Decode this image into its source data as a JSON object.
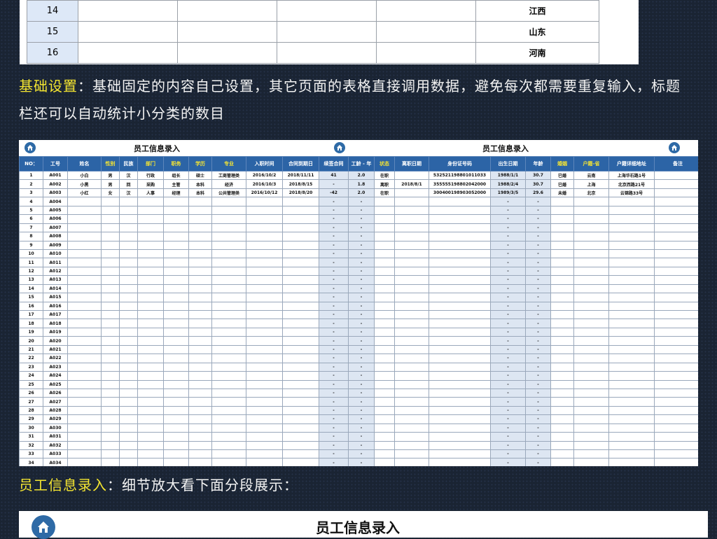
{
  "top_sheet": {
    "rows": [
      {
        "num": "14",
        "province": "江西"
      },
      {
        "num": "15",
        "province": "山东"
      },
      {
        "num": "16",
        "province": "河南"
      }
    ]
  },
  "caption1": {
    "highlight": "基础设置",
    "text": "：基础固定的内容自己设置，其它页面的表格直接调用数据，避免每次都需要重复输入，标题栏还可以自动统计小分类的数目"
  },
  "sheet": {
    "title": "员工信息录入",
    "headers": [
      {
        "label": "NO：",
        "yellow": false
      },
      {
        "label": "工号",
        "yellow": false
      },
      {
        "label": "姓名",
        "yellow": false
      },
      {
        "label": "性别",
        "yellow": true
      },
      {
        "label": "民族",
        "yellow": false
      },
      {
        "label": "部门",
        "yellow": true
      },
      {
        "label": "职务",
        "yellow": true
      },
      {
        "label": "学历",
        "yellow": true
      },
      {
        "label": "专业",
        "yellow": true
      },
      {
        "label": "入职时间",
        "yellow": false
      },
      {
        "label": "合同到期日",
        "yellow": false
      },
      {
        "label": "续签合同",
        "yellow": false
      },
      {
        "label": "工龄 - 年",
        "yellow": false
      },
      {
        "label": "状态",
        "yellow": true
      },
      {
        "label": "离职日期",
        "yellow": false
      },
      {
        "label": "身份证号码",
        "yellow": false
      },
      {
        "label": "出生日期",
        "yellow": false
      },
      {
        "label": "年龄",
        "yellow": false
      },
      {
        "label": "婚姻",
        "yellow": true
      },
      {
        "label": "户籍-省",
        "yellow": true
      },
      {
        "label": "户籍详细地址",
        "yellow": false
      },
      {
        "label": "备注",
        "yellow": false
      }
    ],
    "rows": [
      [
        "1",
        "A001",
        "小白",
        "男",
        "汉",
        "行政",
        "组长",
        "硕士",
        "工商管理类",
        "2016/10/2",
        "2018/11/11",
        "41",
        "2.0",
        "在职",
        "",
        "532521198801011033",
        "1988/1/1",
        "30.7",
        "已婚",
        "云南",
        "上海华石路1号",
        ""
      ],
      [
        "2",
        "A002",
        "小黑",
        "男",
        "回",
        "采购",
        "主管",
        "本科",
        "经济",
        "2016/10/3",
        "2018/8/15",
        "-",
        "1.8",
        "离职",
        "2018/8/1",
        "355555198802042000",
        "1988/2/4",
        "30.7",
        "已婚",
        "上海",
        "北京西路21号",
        ""
      ],
      [
        "3",
        "A003",
        "小红",
        "女",
        "汉",
        "人事",
        "经理",
        "本科",
        "公共管理类",
        "2016/10/12",
        "2018/8/20",
        "-42",
        "2.0",
        "在职",
        "",
        "300400198903052000",
        "1989/3/5",
        "29.6",
        "未婚",
        "北京",
        "云锦路33号",
        ""
      ]
    ],
    "blank_ids": [
      "A004",
      "A005",
      "A006",
      "A007",
      "A008",
      "A009",
      "A010",
      "A011",
      "A012",
      "A013",
      "A014",
      "A015",
      "A016",
      "A017",
      "A018",
      "A019",
      "A020",
      "A021",
      "A022",
      "A023",
      "A024",
      "A025",
      "A026",
      "A027",
      "A028",
      "A029",
      "A030",
      "A031",
      "A032",
      "A033",
      "A034"
    ],
    "blank_nums": [
      "4",
      "5",
      "6",
      "7",
      "8",
      "9",
      "10",
      "11",
      "12",
      "13",
      "14",
      "15",
      "16",
      "17",
      "18",
      "19",
      "20",
      "21",
      "22",
      "23",
      "24",
      "25",
      "26",
      "27",
      "28",
      "29",
      "30",
      "31",
      "32",
      "33",
      "34"
    ],
    "dash": "-"
  },
  "caption2": {
    "highlight": "员工信息录入",
    "text": "：细节放大看下面分段展示："
  },
  "banner": {
    "title": "员工信息录入"
  },
  "colors": {
    "header_blue": "#2c64a6",
    "highlight_yellow": "#f4e531",
    "shaded_cell": "#dde6f2"
  }
}
